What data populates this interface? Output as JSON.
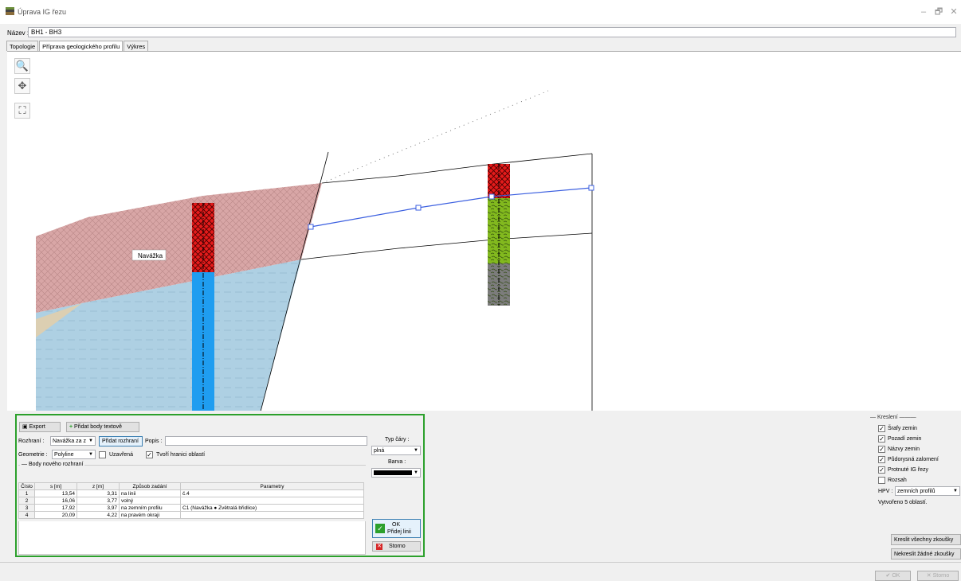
{
  "window": {
    "title": "Úprava IG řezu",
    "minimize": "–",
    "maximize": "🗗",
    "close": "✕"
  },
  "name": {
    "label": "Název :",
    "value": "BH1 - BH3"
  },
  "tabs": [
    "Topologie",
    "Příprava geologického profilu",
    "Výkres"
  ],
  "tools": {
    "zoom": "🔍",
    "pan": "✥",
    "fit": "⛶"
  },
  "canvas": {
    "soil_label": "Navážka"
  },
  "panel": {
    "export": "Export",
    "add_text_points": "Přidat body textově",
    "interface_label": "Rozhraní :",
    "interface_value": "Navážka za z",
    "add_interface": "Přidat rozhraní",
    "description_label": "Popis :",
    "description_value": "",
    "geometry_label": "Geometrie :",
    "geometry_value": "Polyline",
    "closed_label": "Uzavřená",
    "closed_checked": false,
    "boundary_label": "Tvoří hranici oblastí",
    "boundary_checked": true,
    "points_group": "Body nového rozhraní",
    "line_type_label": "Typ čáry :",
    "line_type_value": "plná",
    "color_label": "Barva :",
    "color_value": "#000000",
    "ok_line1": "OK",
    "ok_line2": "Přidej linii",
    "cancel": "Storno"
  },
  "table": {
    "headers": [
      "Číslo",
      "s [m]",
      "z [m]",
      "Způsob zadání",
      "Parametry"
    ],
    "rows": [
      [
        "1",
        "13,54",
        "3,31",
        "na linii",
        "č.4"
      ],
      [
        "2",
        "16,06",
        "3,77",
        "volný",
        ""
      ],
      [
        "3",
        "17,92",
        "3,97",
        "na zemním profilu",
        "C1 (Navážka ● Zvětralá břidlice)"
      ],
      [
        "4",
        "20,09",
        "4,22",
        "na pravém okraji",
        ""
      ]
    ]
  },
  "drawing": {
    "group": "Kreslení",
    "options": [
      {
        "label": "Šrafy zemin",
        "checked": true
      },
      {
        "label": "Pozadí zemin",
        "checked": true
      },
      {
        "label": "Názvy zemin",
        "checked": true
      },
      {
        "label": "Půdorysná zalomení",
        "checked": true
      },
      {
        "label": "Protnuté IG řezy",
        "checked": true
      },
      {
        "label": "Rozsah",
        "checked": false
      }
    ],
    "hpv_label": "HPV :",
    "hpv_value": "zemních profilů",
    "created": "Vytvořeno 5 oblastí.",
    "draw_all": "Kreslit všechny zkoušky",
    "draw_none": "Nekreslit žádné zkoušky"
  },
  "footer": {
    "ok": "✔ OK",
    "cancel": "✕ Storno"
  }
}
